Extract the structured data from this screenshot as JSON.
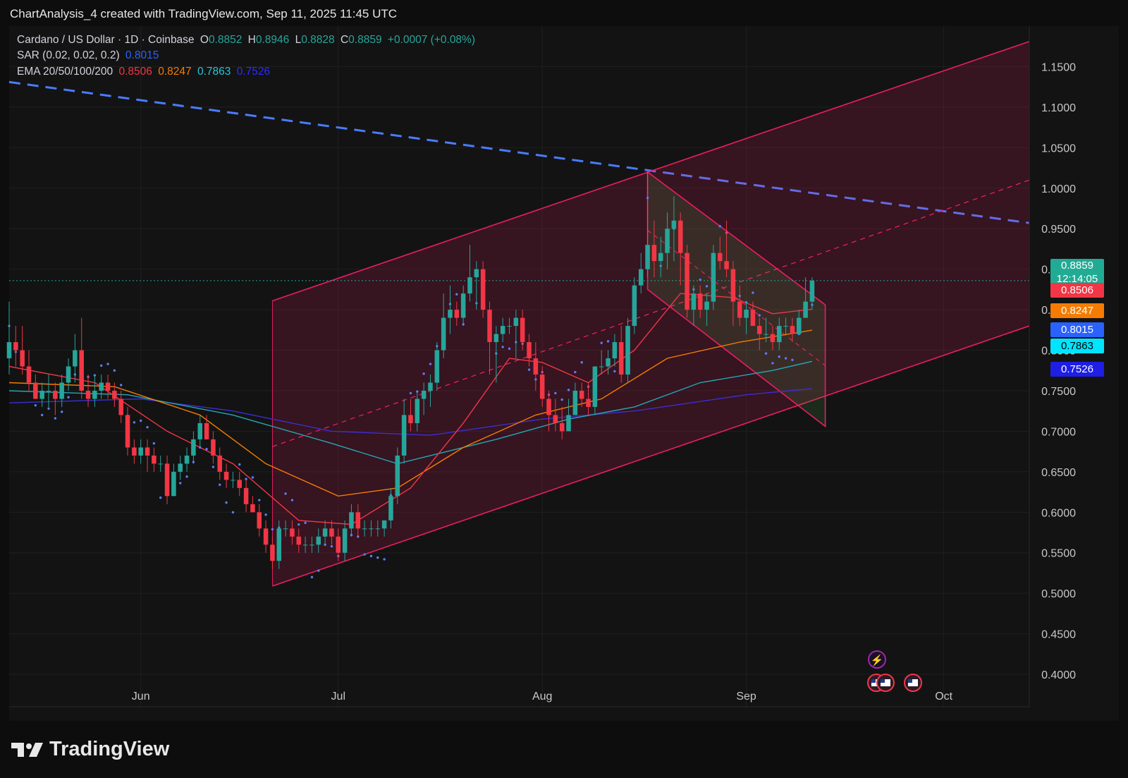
{
  "caption": "ChartAnalysis_4 created with TradingView.com, Sep 11, 2025 11:45 UTC",
  "logo_text": "TradingView",
  "legend": {
    "symbol": "Cardano / US Dollar · 1D · Coinbase",
    "o_label": "O",
    "o": "0.8852",
    "h_label": "H",
    "h": "0.8946",
    "l_label": "L",
    "l": "0.8828",
    "c_label": "C",
    "c": "0.8859",
    "change": "+0.0007 (+0.08%)",
    "sar_label": "SAR (0.02, 0.02, 0.2)",
    "sar": "0.8015",
    "ema_label": "EMA 20/50/100/200",
    "ema20": "0.8506",
    "ema50": "0.8247",
    "ema100": "0.7863",
    "ema200": "0.7526"
  },
  "badges": {
    "price": "0.8859",
    "countdown": "12:14:05",
    "ema20": "0.8506",
    "ema50": "0.8247",
    "sar": "0.8015",
    "ema100": "0.7863",
    "ema200": "0.7526"
  },
  "colors": {
    "up": "#26a69a",
    "down": "#f23645",
    "ema20": "#f23645",
    "ema50": "#f57c00",
    "ema100": "#26a6b4",
    "ema200": "#3b2fd4",
    "sar": "#5d7cff",
    "trendline": "#4a7cff",
    "channel": "#e91e63",
    "wedge": "#4caf50",
    "badge_sar": "#2962ff",
    "badge_ema100": "#00e5ff",
    "badge_ema200": "#1e1ee6"
  },
  "chart_data": {
    "type": "candlestick",
    "title": "Cardano / US Dollar · 1D · Coinbase",
    "x_ticks": [
      "Jun",
      "Jul",
      "Aug",
      "Sep",
      "Oct"
    ],
    "y_ticks": [
      "0.4000",
      "0.4500",
      "0.5000",
      "0.5500",
      "0.6000",
      "0.6500",
      "0.7000",
      "0.7500",
      "0.8000",
      "0.8500",
      "0.9000",
      "0.9500",
      "1.0000",
      "1.0500",
      "1.1000",
      "1.1500"
    ],
    "ylim": [
      0.36,
      1.2
    ],
    "x_range": [
      "2025-05-12",
      "2025-10-14"
    ],
    "candles": [
      [
        "2025-05-12",
        0.79,
        0.86,
        0.77,
        0.81
      ],
      [
        "2025-05-13",
        0.81,
        0.83,
        0.78,
        0.8
      ],
      [
        "2025-05-14",
        0.8,
        0.83,
        0.77,
        0.78
      ],
      [
        "2025-05-15",
        0.78,
        0.8,
        0.75,
        0.76
      ],
      [
        "2025-05-16",
        0.76,
        0.77,
        0.74,
        0.74
      ],
      [
        "2025-05-17",
        0.74,
        0.76,
        0.73,
        0.75
      ],
      [
        "2025-05-18",
        0.75,
        0.77,
        0.73,
        0.75
      ],
      [
        "2025-05-19",
        0.75,
        0.76,
        0.72,
        0.74
      ],
      [
        "2025-05-20",
        0.74,
        0.77,
        0.73,
        0.76
      ],
      [
        "2025-05-21",
        0.76,
        0.79,
        0.75,
        0.78
      ],
      [
        "2025-05-22",
        0.78,
        0.82,
        0.76,
        0.8
      ],
      [
        "2025-05-23",
        0.8,
        0.84,
        0.74,
        0.75
      ],
      [
        "2025-05-24",
        0.75,
        0.77,
        0.73,
        0.74
      ],
      [
        "2025-05-25",
        0.74,
        0.77,
        0.73,
        0.75
      ],
      [
        "2025-05-26",
        0.75,
        0.77,
        0.74,
        0.76
      ],
      [
        "2025-05-27",
        0.76,
        0.77,
        0.74,
        0.75
      ],
      [
        "2025-05-28",
        0.75,
        0.76,
        0.73,
        0.74
      ],
      [
        "2025-05-29",
        0.74,
        0.75,
        0.71,
        0.72
      ],
      [
        "2025-05-30",
        0.72,
        0.73,
        0.67,
        0.68
      ],
      [
        "2025-05-31",
        0.68,
        0.69,
        0.66,
        0.67
      ],
      [
        "2025-06-01",
        0.67,
        0.69,
        0.66,
        0.68
      ],
      [
        "2025-06-02",
        0.68,
        0.69,
        0.65,
        0.67
      ],
      [
        "2025-06-03",
        0.67,
        0.68,
        0.65,
        0.66
      ],
      [
        "2025-06-04",
        0.66,
        0.67,
        0.65,
        0.66
      ],
      [
        "2025-06-05",
        0.66,
        0.67,
        0.61,
        0.62
      ],
      [
        "2025-06-06",
        0.62,
        0.66,
        0.62,
        0.65
      ],
      [
        "2025-06-07",
        0.65,
        0.67,
        0.64,
        0.66
      ],
      [
        "2025-06-08",
        0.66,
        0.68,
        0.65,
        0.67
      ],
      [
        "2025-06-09",
        0.67,
        0.7,
        0.66,
        0.69
      ],
      [
        "2025-06-10",
        0.69,
        0.72,
        0.68,
        0.71
      ],
      [
        "2025-06-11",
        0.71,
        0.72,
        0.69,
        0.69
      ],
      [
        "2025-06-12",
        0.69,
        0.7,
        0.66,
        0.67
      ],
      [
        "2025-06-13",
        0.67,
        0.68,
        0.64,
        0.65
      ],
      [
        "2025-06-14",
        0.65,
        0.66,
        0.63,
        0.64
      ],
      [
        "2025-06-15",
        0.64,
        0.65,
        0.63,
        0.64
      ],
      [
        "2025-06-16",
        0.64,
        0.65,
        0.62,
        0.63
      ],
      [
        "2025-06-17",
        0.63,
        0.64,
        0.6,
        0.61
      ],
      [
        "2025-06-18",
        0.61,
        0.62,
        0.6,
        0.6
      ],
      [
        "2025-06-19",
        0.6,
        0.61,
        0.57,
        0.58
      ],
      [
        "2025-06-20",
        0.58,
        0.59,
        0.55,
        0.56
      ],
      [
        "2025-06-21",
        0.56,
        0.57,
        0.53,
        0.54
      ],
      [
        "2025-06-22",
        0.54,
        0.59,
        0.53,
        0.58
      ],
      [
        "2025-06-23",
        0.58,
        0.59,
        0.57,
        0.58
      ],
      [
        "2025-06-24",
        0.58,
        0.59,
        0.56,
        0.57
      ],
      [
        "2025-06-25",
        0.57,
        0.58,
        0.55,
        0.56
      ],
      [
        "2025-06-26",
        0.56,
        0.57,
        0.55,
        0.56
      ],
      [
        "2025-06-27",
        0.56,
        0.57,
        0.55,
        0.56
      ],
      [
        "2025-06-28",
        0.56,
        0.58,
        0.55,
        0.57
      ],
      [
        "2025-06-29",
        0.57,
        0.59,
        0.56,
        0.58
      ],
      [
        "2025-06-30",
        0.58,
        0.59,
        0.56,
        0.57
      ],
      [
        "2025-07-01",
        0.57,
        0.58,
        0.54,
        0.55
      ],
      [
        "2025-07-02",
        0.55,
        0.59,
        0.54,
        0.58
      ],
      [
        "2025-07-03",
        0.58,
        0.61,
        0.57,
        0.6
      ],
      [
        "2025-07-04",
        0.6,
        0.61,
        0.57,
        0.58
      ],
      [
        "2025-07-05",
        0.58,
        0.59,
        0.57,
        0.58
      ],
      [
        "2025-07-06",
        0.58,
        0.59,
        0.57,
        0.58
      ],
      [
        "2025-07-07",
        0.58,
        0.59,
        0.57,
        0.58
      ],
      [
        "2025-07-08",
        0.58,
        0.59,
        0.57,
        0.59
      ],
      [
        "2025-07-09",
        0.59,
        0.63,
        0.58,
        0.62
      ],
      [
        "2025-07-10",
        0.62,
        0.68,
        0.61,
        0.67
      ],
      [
        "2025-07-11",
        0.67,
        0.74,
        0.66,
        0.72
      ],
      [
        "2025-07-12",
        0.72,
        0.74,
        0.7,
        0.71
      ],
      [
        "2025-07-13",
        0.71,
        0.75,
        0.7,
        0.74
      ],
      [
        "2025-07-14",
        0.74,
        0.76,
        0.72,
        0.75
      ],
      [
        "2025-07-15",
        0.75,
        0.77,
        0.73,
        0.76
      ],
      [
        "2025-07-16",
        0.76,
        0.81,
        0.75,
        0.8
      ],
      [
        "2025-07-17",
        0.8,
        0.87,
        0.79,
        0.84
      ],
      [
        "2025-07-18",
        0.84,
        0.88,
        0.82,
        0.85
      ],
      [
        "2025-07-19",
        0.85,
        0.86,
        0.83,
        0.84
      ],
      [
        "2025-07-20",
        0.84,
        0.88,
        0.83,
        0.87
      ],
      [
        "2025-07-21",
        0.87,
        0.93,
        0.86,
        0.89
      ],
      [
        "2025-07-22",
        0.89,
        0.91,
        0.85,
        0.9
      ],
      [
        "2025-07-23",
        0.9,
        0.91,
        0.84,
        0.85
      ],
      [
        "2025-07-24",
        0.85,
        0.86,
        0.77,
        0.81
      ],
      [
        "2025-07-25",
        0.81,
        0.83,
        0.76,
        0.82
      ],
      [
        "2025-07-26",
        0.82,
        0.84,
        0.81,
        0.83
      ],
      [
        "2025-07-27",
        0.83,
        0.84,
        0.82,
        0.83
      ],
      [
        "2025-07-28",
        0.83,
        0.85,
        0.79,
        0.84
      ],
      [
        "2025-07-29",
        0.84,
        0.85,
        0.8,
        0.81
      ],
      [
        "2025-07-30",
        0.81,
        0.82,
        0.78,
        0.79
      ],
      [
        "2025-07-31",
        0.79,
        0.81,
        0.75,
        0.77
      ],
      [
        "2025-08-01",
        0.77,
        0.78,
        0.73,
        0.74
      ],
      [
        "2025-08-02",
        0.74,
        0.75,
        0.7,
        0.72
      ],
      [
        "2025-08-03",
        0.72,
        0.74,
        0.7,
        0.71
      ],
      [
        "2025-08-04",
        0.71,
        0.73,
        0.69,
        0.7
      ],
      [
        "2025-08-05",
        0.7,
        0.74,
        0.7,
        0.72
      ],
      [
        "2025-08-06",
        0.72,
        0.76,
        0.72,
        0.75
      ],
      [
        "2025-08-07",
        0.75,
        0.76,
        0.73,
        0.74
      ],
      [
        "2025-08-08",
        0.74,
        0.76,
        0.72,
        0.73
      ],
      [
        "2025-08-09",
        0.73,
        0.78,
        0.72,
        0.78
      ],
      [
        "2025-08-10",
        0.78,
        0.8,
        0.77,
        0.78
      ],
      [
        "2025-08-11",
        0.78,
        0.8,
        0.77,
        0.79
      ],
      [
        "2025-08-12",
        0.79,
        0.82,
        0.78,
        0.81
      ],
      [
        "2025-08-13",
        0.81,
        0.83,
        0.76,
        0.77
      ],
      [
        "2025-08-14",
        0.77,
        0.84,
        0.76,
        0.83
      ],
      [
        "2025-08-15",
        0.83,
        0.89,
        0.82,
        0.88
      ],
      [
        "2025-08-16",
        0.88,
        0.92,
        0.87,
        0.9
      ],
      [
        "2025-08-17",
        0.9,
        1.02,
        0.89,
        0.93
      ],
      [
        "2025-08-18",
        0.93,
        0.96,
        0.89,
        0.91
      ],
      [
        "2025-08-19",
        0.91,
        0.94,
        0.89,
        0.92
      ],
      [
        "2025-08-20",
        0.92,
        0.97,
        0.9,
        0.95
      ],
      [
        "2025-08-21",
        0.95,
        0.99,
        0.91,
        0.96
      ],
      [
        "2025-08-22",
        0.96,
        0.97,
        0.88,
        0.92
      ],
      [
        "2025-08-23",
        0.92,
        0.93,
        0.84,
        0.85
      ],
      [
        "2025-08-24",
        0.85,
        0.88,
        0.83,
        0.87
      ],
      [
        "2025-08-25",
        0.87,
        0.88,
        0.84,
        0.85
      ],
      [
        "2025-08-26",
        0.85,
        0.87,
        0.83,
        0.86
      ],
      [
        "2025-08-27",
        0.86,
        0.93,
        0.85,
        0.92
      ],
      [
        "2025-08-28",
        0.92,
        0.94,
        0.9,
        0.91
      ],
      [
        "2025-08-29",
        0.91,
        0.96,
        0.89,
        0.9
      ],
      [
        "2025-08-30",
        0.9,
        0.91,
        0.83,
        0.86
      ],
      [
        "2025-08-31",
        0.86,
        0.88,
        0.83,
        0.84
      ],
      [
        "2025-09-01",
        0.84,
        0.86,
        0.82,
        0.85
      ],
      [
        "2025-09-02",
        0.85,
        0.86,
        0.83,
        0.83
      ],
      [
        "2025-09-03",
        0.83,
        0.84,
        0.8,
        0.82
      ],
      [
        "2025-09-04",
        0.82,
        0.84,
        0.81,
        0.82
      ],
      [
        "2025-09-05",
        0.82,
        0.83,
        0.8,
        0.81
      ],
      [
        "2025-09-06",
        0.81,
        0.84,
        0.8,
        0.83
      ],
      [
        "2025-09-07",
        0.83,
        0.84,
        0.82,
        0.83
      ],
      [
        "2025-09-08",
        0.83,
        0.84,
        0.81,
        0.82
      ],
      [
        "2025-09-09",
        0.82,
        0.85,
        0.82,
        0.84
      ],
      [
        "2025-09-10",
        0.84,
        0.89,
        0.84,
        0.86
      ],
      [
        "2025-09-11",
        0.86,
        0.89,
        0.85,
        0.8859
      ]
    ],
    "ema20": [
      [
        "2025-05-12",
        0.78
      ],
      [
        "2025-05-25",
        0.76
      ],
      [
        "2025-06-05",
        0.7
      ],
      [
        "2025-06-15",
        0.66
      ],
      [
        "2025-06-25",
        0.59
      ],
      [
        "2025-07-03",
        0.585
      ],
      [
        "2025-07-12",
        0.63
      ],
      [
        "2025-07-20",
        0.71
      ],
      [
        "2025-07-27",
        0.79
      ],
      [
        "2025-08-01",
        0.785
      ],
      [
        "2025-08-08",
        0.76
      ],
      [
        "2025-08-15",
        0.8
      ],
      [
        "2025-08-22",
        0.87
      ],
      [
        "2025-08-30",
        0.865
      ],
      [
        "2025-09-05",
        0.845
      ],
      [
        "2025-09-11",
        0.8506
      ]
    ],
    "ema50": [
      [
        "2025-05-12",
        0.76
      ],
      [
        "2025-05-28",
        0.755
      ],
      [
        "2025-06-10",
        0.72
      ],
      [
        "2025-06-20",
        0.66
      ],
      [
        "2025-07-01",
        0.62
      ],
      [
        "2025-07-10",
        0.63
      ],
      [
        "2025-07-20",
        0.68
      ],
      [
        "2025-07-31",
        0.72
      ],
      [
        "2025-08-10",
        0.74
      ],
      [
        "2025-08-20",
        0.79
      ],
      [
        "2025-08-31",
        0.81
      ],
      [
        "2025-09-11",
        0.8247
      ]
    ],
    "ema100": [
      [
        "2025-05-12",
        0.75
      ],
      [
        "2025-05-30",
        0.745
      ],
      [
        "2025-06-15",
        0.72
      ],
      [
        "2025-06-30",
        0.685
      ],
      [
        "2025-07-10",
        0.66
      ],
      [
        "2025-07-25",
        0.69
      ],
      [
        "2025-08-05",
        0.715
      ],
      [
        "2025-08-15",
        0.73
      ],
      [
        "2025-08-25",
        0.76
      ],
      [
        "2025-09-05",
        0.775
      ],
      [
        "2025-09-11",
        0.7863
      ]
    ],
    "ema200": [
      [
        "2025-05-12",
        0.735
      ],
      [
        "2025-06-01",
        0.74
      ],
      [
        "2025-06-15",
        0.725
      ],
      [
        "2025-06-30",
        0.7
      ],
      [
        "2025-07-15",
        0.695
      ],
      [
        "2025-08-01",
        0.715
      ],
      [
        "2025-08-15",
        0.725
      ],
      [
        "2025-09-01",
        0.745
      ],
      [
        "2025-09-11",
        0.7526
      ]
    ],
    "sar": [
      [
        0.72,
        0.74,
        0.75,
        0.76,
        0.76,
        0.76,
        0.77,
        0.77,
        0.78,
        0.78,
        0.78,
        0.78,
        0.79,
        0.79,
        0.8,
        0.8
      ],
      {
        "start": "2025-05-12",
        "note": ""
      }
    ],
    "last_price": 0.8859
  }
}
